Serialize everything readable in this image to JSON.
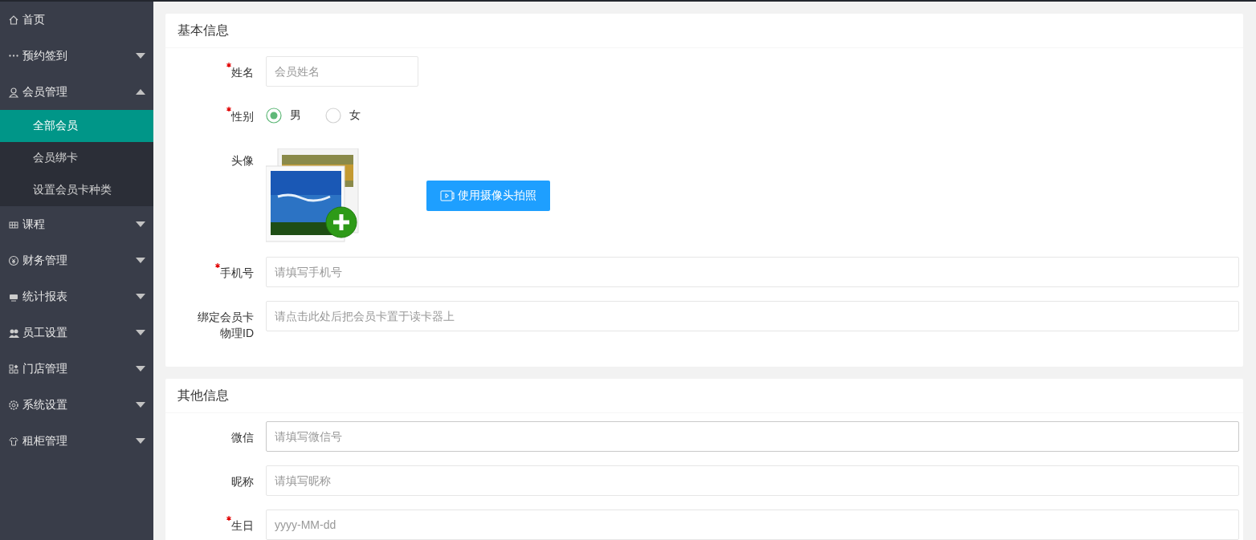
{
  "sidebar": {
    "items": [
      {
        "label": "首页"
      },
      {
        "label": "预约签到",
        "expanded": false
      },
      {
        "label": "会员管理",
        "expanded": true,
        "children": [
          {
            "label": "全部会员",
            "selected": true
          },
          {
            "label": "会员绑卡",
            "selected": false
          },
          {
            "label": "设置会员卡种类",
            "selected": false
          }
        ]
      },
      {
        "label": "课程",
        "expanded": false
      },
      {
        "label": "财务管理",
        "expanded": false
      },
      {
        "label": "统计报表",
        "expanded": false
      },
      {
        "label": "员工设置",
        "expanded": false
      },
      {
        "label": "门店管理",
        "expanded": false
      },
      {
        "label": "系统设置",
        "expanded": false
      },
      {
        "label": "租柜管理",
        "expanded": false
      }
    ]
  },
  "sections": [
    {
      "title": "基本信息",
      "fields": [
        {
          "kind": "text",
          "label": "姓名",
          "required": true,
          "placeholder": "会员姓名",
          "short": true,
          "focused": false
        },
        {
          "kind": "radio",
          "label": "性别",
          "required": true,
          "options": [
            {
              "label": "男",
              "selected": true
            },
            {
              "label": "女",
              "selected": false
            }
          ]
        },
        {
          "kind": "avatar",
          "label": "头像",
          "required": false,
          "button": "使用摄像头拍照"
        },
        {
          "kind": "text",
          "label": "手机号",
          "required": true,
          "placeholder": "请填写手机号",
          "short": false,
          "focused": false
        },
        {
          "kind": "text",
          "label": "绑定会员卡物理ID",
          "required": false,
          "placeholder": "请点击此处后把会员卡置于读卡器上",
          "short": false,
          "focused": false
        }
      ]
    },
    {
      "title": "其他信息",
      "fields": [
        {
          "kind": "text",
          "label": "微信",
          "required": false,
          "placeholder": "请填写微信号",
          "short": false,
          "focused": true
        },
        {
          "kind": "text",
          "label": "昵称",
          "required": false,
          "placeholder": "请填写昵称",
          "short": false,
          "focused": false
        },
        {
          "kind": "text",
          "label": "生日",
          "required": true,
          "placeholder": "yyyy-MM-dd",
          "short": false,
          "focused": false
        }
      ]
    }
  ]
}
